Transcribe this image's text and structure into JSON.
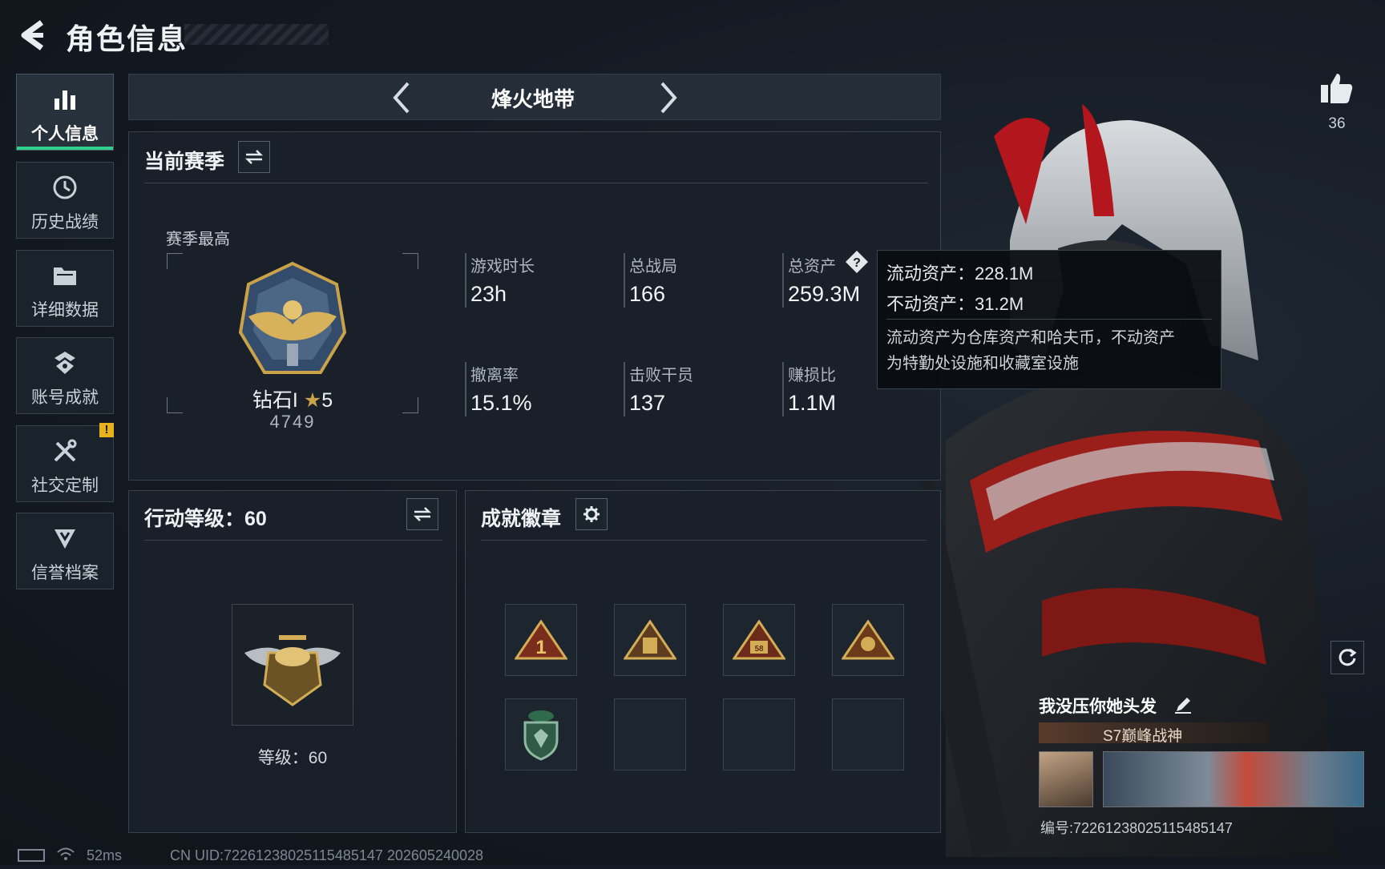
{
  "header": {
    "title": "角色信息"
  },
  "sidebar": {
    "items": [
      {
        "label": "个人信息",
        "icon": "bar-chart-icon",
        "active": true
      },
      {
        "label": "历史战绩",
        "icon": "history-icon"
      },
      {
        "label": "详细数据",
        "icon": "folder-icon"
      },
      {
        "label": "账号成就",
        "icon": "achievement-icon"
      },
      {
        "label": "社交定制",
        "icon": "tools-icon",
        "badge": "!"
      },
      {
        "label": "信誉档案",
        "icon": "credit-shield-icon"
      }
    ]
  },
  "mode": {
    "label": "烽火地带"
  },
  "season": {
    "title": "当前赛季",
    "best_label": "赛季最高",
    "rank_name": "钻石I",
    "rank_stars": "5",
    "rank_score": "4749",
    "stats": [
      {
        "label": "游戏时长",
        "value": "23h"
      },
      {
        "label": "总战局",
        "value": "166"
      },
      {
        "label": "总资产",
        "value": "259.3M"
      },
      {
        "label": "撤离率",
        "value": "15.1%"
      },
      {
        "label": "击败干员",
        "value": "137"
      },
      {
        "label": "赚损比",
        "value": "1.1M"
      }
    ]
  },
  "tooltip": {
    "liquid": "流动资产：228.1M",
    "fixed": "不动资产：31.2M",
    "desc1": "流动资产为仓库资产和哈夫币，不动资产",
    "desc2": "为特勤处设施和收藏室设施"
  },
  "action_level": {
    "title": "行动等级：60",
    "level_text": "等级：60"
  },
  "badges": {
    "title": "成就徽章",
    "first_badge_number": "1",
    "third_badge_number": "58"
  },
  "likes": {
    "count": "36"
  },
  "player": {
    "name": "我没压你她头发",
    "title": "S7巅峰战神",
    "id": "编号:72261238025115485147"
  },
  "footer": {
    "ping": "52ms",
    "uid": "CN UID:72261238025115485147  202605240028"
  },
  "colors": {
    "accent_green": "#2fd08b",
    "gold": "#c9a24a",
    "warning": "#e8b21c"
  }
}
